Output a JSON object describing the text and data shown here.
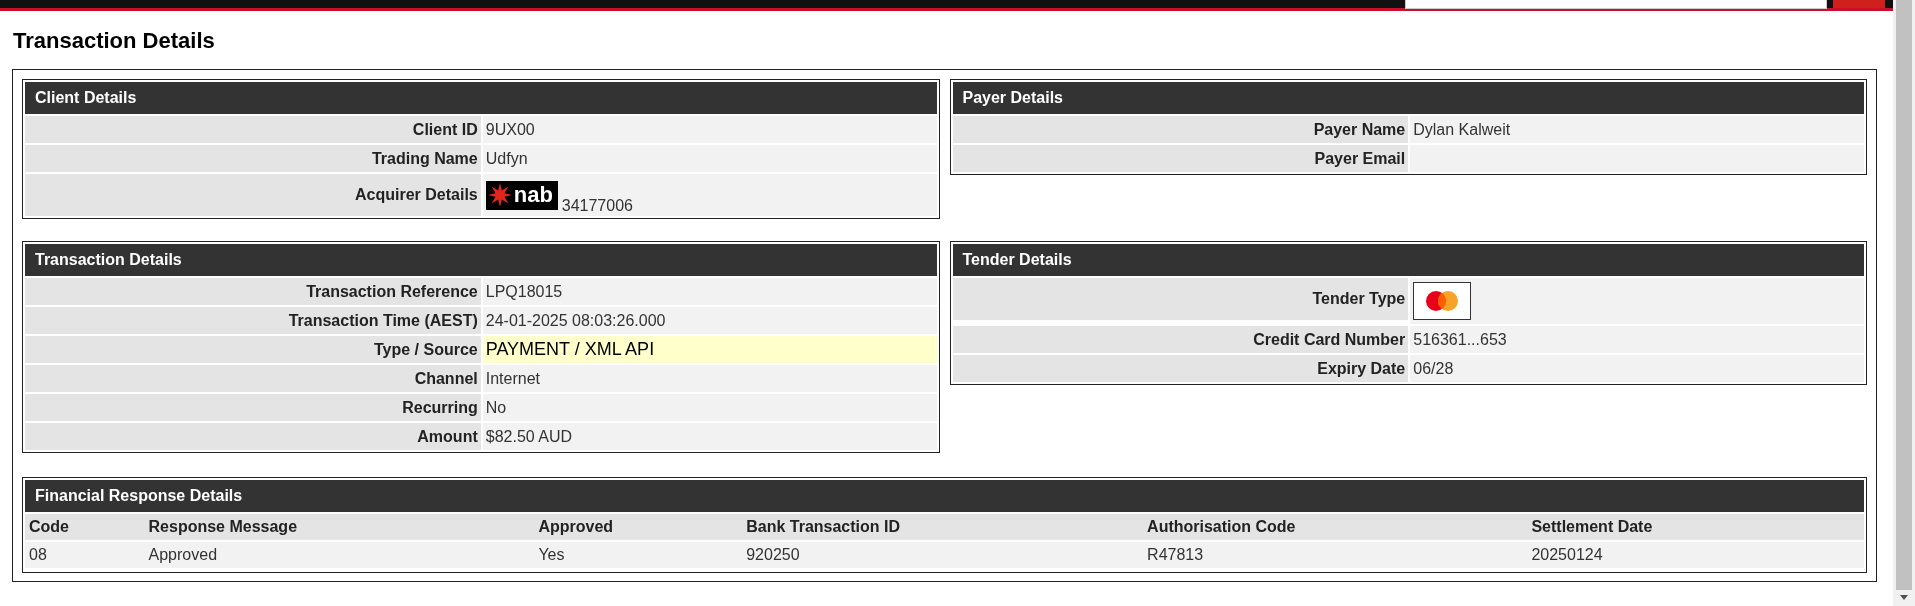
{
  "page_title": "Transaction Details",
  "panels": [
    {
      "title": "Client Details",
      "rows": [
        {
          "kind": "text",
          "label": "Client ID",
          "value": "9UX00",
          "highlighted": false
        },
        {
          "kind": "text",
          "label": "Trading Name",
          "value": "Udfyn",
          "highlighted": false
        },
        {
          "kind": "logo",
          "label": "Acquirer Details",
          "logo_text": "nab",
          "value": "34177006",
          "highlighted": false
        }
      ]
    },
    {
      "title": "Payer Details",
      "rows": [
        {
          "kind": "text",
          "label": "Payer Name",
          "value": "Dylan Kalweit",
          "highlighted": false
        },
        {
          "kind": "text",
          "label": "Payer Email",
          "highlighted": false
        }
      ]
    },
    {
      "title": "Transaction Details",
      "rows": [
        {
          "kind": "text",
          "label": "Transaction Reference",
          "value": "LPQ18015",
          "highlighted": false
        },
        {
          "kind": "text",
          "label": "Transaction Time (AEST)",
          "value": "24-01-2025 08:03:26.000",
          "highlighted": false
        },
        {
          "kind": "text",
          "label": "Type / Source",
          "value": "PAYMENT / XML API",
          "highlighted": true
        },
        {
          "kind": "text",
          "label": "Channel",
          "value": "Internet",
          "highlighted": false
        },
        {
          "kind": "text",
          "label": "Recurring",
          "value": "No",
          "highlighted": false
        },
        {
          "kind": "text",
          "label": "Amount",
          "value": "$82.50 AUD",
          "highlighted": false
        }
      ]
    },
    {
      "title": "Tender Details",
      "rows": [
        {
          "kind": "card",
          "label": "Tender Type",
          "highlighted": false
        },
        {
          "kind": "text",
          "label": "Credit Card Number",
          "value": "516361...653",
          "highlighted": false
        },
        {
          "kind": "text",
          "label": "Expiry Date",
          "value": "06/28",
          "highlighted": false
        }
      ]
    }
  ],
  "financial_response": {
    "title": "Financial Response Details",
    "columns": [
      "Code",
      "Response Message",
      "Approved",
      "Bank Transaction ID",
      "Authorisation Code",
      "Settlement Date"
    ],
    "rows": [
      [
        "08",
        "Approved",
        "Yes",
        "920250",
        "R47813",
        "20250124"
      ]
    ]
  }
}
